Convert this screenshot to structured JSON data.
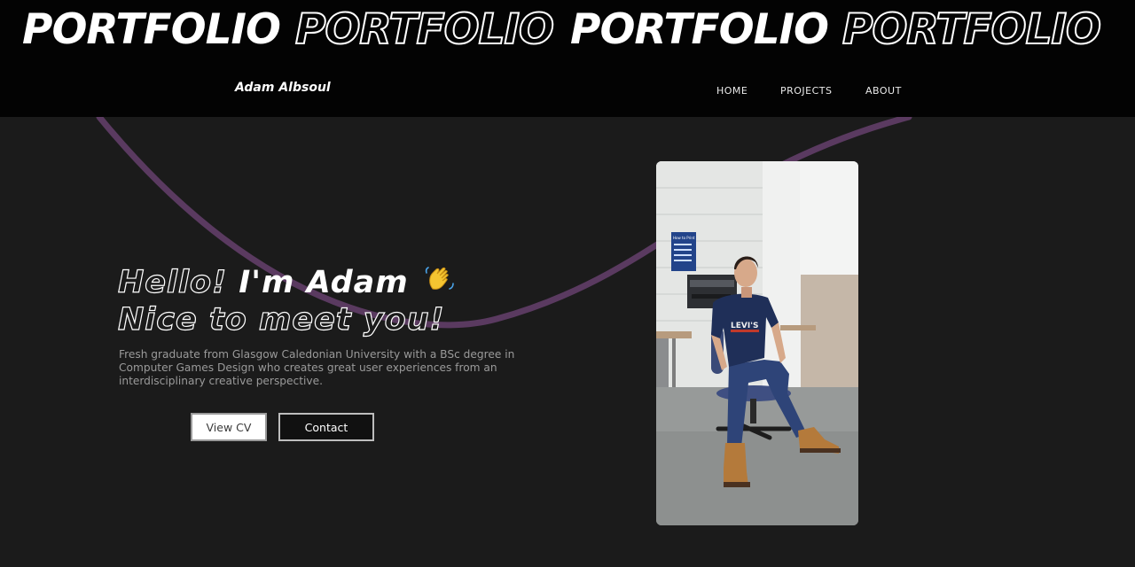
{
  "marquee": {
    "words": [
      "PORTFOLIO",
      "PORTFOLIO",
      "PORTFOLIO",
      "PORTFOLIO"
    ]
  },
  "nav": {
    "brand": "Adam Albsoul",
    "links": [
      "HOME",
      "PROJECTS",
      "ABOUT"
    ]
  },
  "hero": {
    "hello": "Hello!",
    "name": "I'm Adam",
    "greeting_icon": "waving-hand-icon",
    "nice": "Nice to meet you!",
    "description": "Fresh graduate from Glasgow Caledonian University with a BSc degree in Computer Games Design who creates great user experiences from an interdisciplinary creative perspective.",
    "buttons": {
      "cv": "View CV",
      "contact": "Contact"
    }
  },
  "photo": {
    "poster_title": "How to Print",
    "shirt_text": "LEVI'S"
  },
  "colors": {
    "background": "#1b1b1b",
    "header": "#030303",
    "curve": "#5a3a60",
    "text": "#ffffff",
    "muted": "#9a9a9a"
  }
}
